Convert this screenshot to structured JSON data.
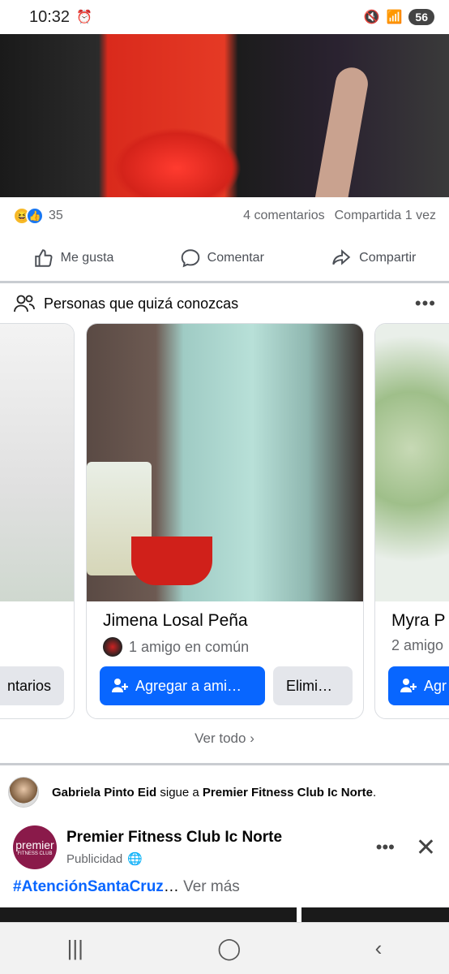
{
  "status": {
    "time": "10:32",
    "battery": "56"
  },
  "post": {
    "reaction_count": "35",
    "comments": "4 comentarios",
    "shares": "Compartida 1 vez",
    "actions": {
      "like": "Me gusta",
      "comment": "Comentar",
      "share": "Compartir"
    }
  },
  "pymk": {
    "title": "Personas que quizá conozcas",
    "cards": [
      {
        "name": "",
        "mutual": "",
        "add": "",
        "secondary": "ntarios"
      },
      {
        "name": "Jimena Losal Peña",
        "mutual": "1 amigo en común",
        "add": "Agregar a ami…",
        "secondary": "Elimi…"
      },
      {
        "name": "Myra P",
        "mutual": "2 amigo",
        "add": "Agr",
        "secondary": ""
      }
    ],
    "see_all": "Ver todo"
  },
  "follow": {
    "person": "Gabriela Pinto Eid",
    "verb": " sigue a ",
    "page": "Premier Fitness Club Ic Norte",
    "end": "."
  },
  "ad": {
    "logo_text": "premier",
    "logo_sub": "FITNESS CLUB",
    "name": "Premier Fitness Club Ic Norte",
    "sponsored": "Publicidad",
    "hashtag": "#AtenciónSantaCruz",
    "ellipsis": "… ",
    "see_more": "Ver más"
  },
  "colors": {
    "accent": "#0866ff",
    "secondary_text": "#65676b",
    "divider": "#c9ccd1"
  }
}
